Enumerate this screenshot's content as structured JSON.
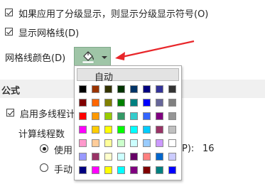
{
  "options": {
    "outline_symbols_label": "如果应用了分级显示，则显示分级显示符号(O)",
    "gridlines_label": "显示网格线(D)",
    "gridline_color_label": "网格线颜色(D)"
  },
  "section": {
    "title": "公式",
    "multithread_label": "启用多线程计",
    "threads_label": "计算线程数",
    "use_all_label": "使用",
    "use_all_suffix": "P):",
    "thread_count": "16",
    "manual_label": "手动"
  },
  "color_picker": {
    "auto_label": "自动",
    "colors": [
      [
        "#000000",
        "#993300",
        "#333300",
        "#003300",
        "#003366",
        "#000080",
        "#333399",
        "#333333"
      ],
      [
        "#800000",
        "#ff6600",
        "#808000",
        "#008000",
        "#008080",
        "#0000ff",
        "#666699",
        "#808080"
      ],
      [
        "#ff0000",
        "#ff9900",
        "#99cc00",
        "#339966",
        "#33cccc",
        "#3366ff",
        "#800080",
        "#969696"
      ],
      [
        "#ff00ff",
        "#ffcc00",
        "#ffff00",
        "#00ff00",
        "#00ffff",
        "#00ccff",
        "#993366",
        "#c0c0c0"
      ],
      [
        "#ff99cc",
        "#ffcc99",
        "#ffff99",
        "#ccffcc",
        "#ccffff",
        "#99ccff",
        "#cc99ff",
        "#ffffff"
      ],
      [
        "#9999ff",
        "#993366",
        "#ffffcc",
        "#ccffff",
        "#660066",
        "#ff8080",
        "#0066cc",
        "#ccccff"
      ],
      [
        "#000080",
        "#ff00ff",
        "#ffff00",
        "#00ffff",
        "#800080",
        "#800000",
        "#008080",
        "#0000ff"
      ]
    ]
  },
  "colors": {
    "button_bg": "#9fc5a7",
    "arrow": "#e8262a"
  }
}
